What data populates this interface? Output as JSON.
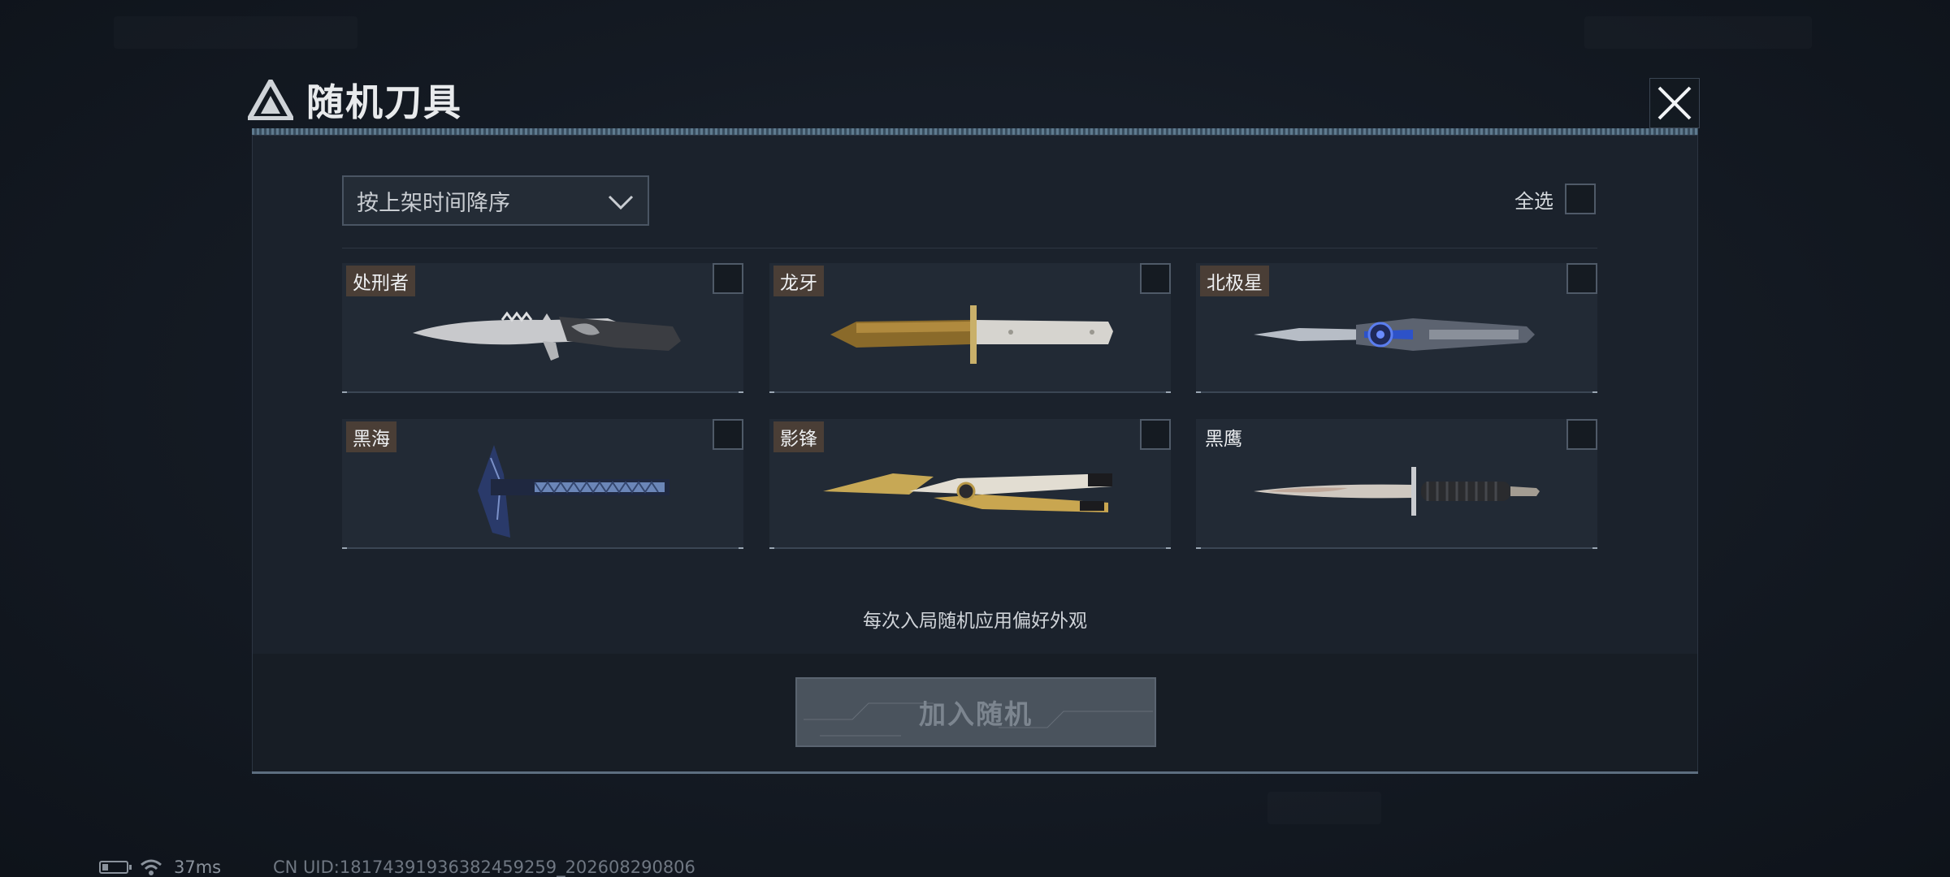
{
  "dialog": {
    "title": "随机刀具",
    "close_icon": "close-icon"
  },
  "toolbar": {
    "sort_value": "按上架时间降序",
    "select_all_label": "全选"
  },
  "items": [
    {
      "name": "处刑者",
      "checked": false
    },
    {
      "name": "龙牙",
      "checked": false
    },
    {
      "name": "北极星",
      "checked": false
    },
    {
      "name": "黑海",
      "checked": false
    },
    {
      "name": "影锋",
      "checked": false
    },
    {
      "name": "黑鹰",
      "checked": false
    }
  ],
  "hint": "每次入局随机应用偏好外观",
  "confirm_label": "加入随机",
  "status": {
    "ping": "37ms",
    "uid": "CN UID:18174391936382459259_202608290806"
  },
  "colors": {
    "panel": "#1b222c",
    "card": "#222a35",
    "accent_bar": "#6b8aa0",
    "button_disabled": "#4a535d"
  }
}
